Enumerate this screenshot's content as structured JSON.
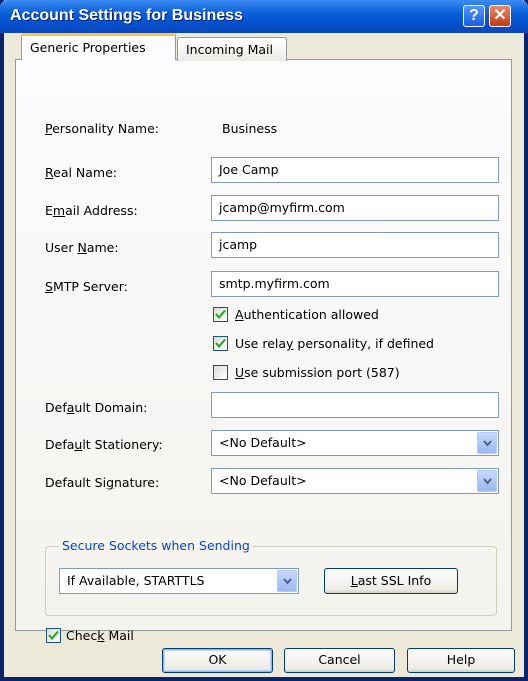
{
  "window": {
    "title": "Account Settings for Business",
    "help_glyph": "?",
    "close_glyph": "✕"
  },
  "tabs": [
    {
      "label": "Generic Properties"
    },
    {
      "label": "Incoming Mail"
    }
  ],
  "form": {
    "personality_label_pre": "",
    "personality_label_key": "P",
    "personality_label_post": "ersonality Name:",
    "personality_value": "Business",
    "realname_label_pre": "",
    "realname_label_key": "R",
    "realname_label_post": "eal Name:",
    "realname_value": "Joe Camp",
    "email_label_pre": "E",
    "email_label_key": "m",
    "email_label_post": "ail Address:",
    "email_value": "jcamp@myfirm.com",
    "username_label_pre": "User ",
    "username_label_key": "N",
    "username_label_post": "ame:",
    "username_value": "jcamp",
    "smtp_label_pre": "",
    "smtp_label_key": "S",
    "smtp_label_post": "MTP Server:",
    "smtp_value": "smtp.myfirm.com",
    "auth_pre": "",
    "auth_key": "A",
    "auth_post": "uthentication allowed",
    "auth_checked": true,
    "relay_pre": "Use rela",
    "relay_key": "y",
    "relay_post": " personality, if defined",
    "relay_checked": true,
    "submission_pre": "",
    "submission_key": "U",
    "submission_post": "se submission port (587)",
    "submission_checked": false,
    "domain_label_pre": "Def",
    "domain_label_key": "a",
    "domain_label_post": "ult Domain:",
    "domain_value": "",
    "stationery_label_pre": "Defa",
    "stationery_label_key": "u",
    "stationery_label_post": "lt Stationery:",
    "stationery_value": "<No Default>",
    "signature_label_pre": "Default Si",
    "signature_label_key": "g",
    "signature_label_post": "nature:",
    "signature_value": "<No Default>"
  },
  "ssl": {
    "group_title": "Secure Sockets when Sending",
    "mode_value": "If Available, STARTTLS",
    "last_ssl_pre": "",
    "last_ssl_key": "L",
    "last_ssl_post": "ast SSL Info"
  },
  "checkmail": {
    "pre": "Chec",
    "key": "k",
    "post": " Mail",
    "checked": true
  },
  "buttons": {
    "ok": "OK",
    "cancel": "Cancel",
    "help": "Help"
  }
}
